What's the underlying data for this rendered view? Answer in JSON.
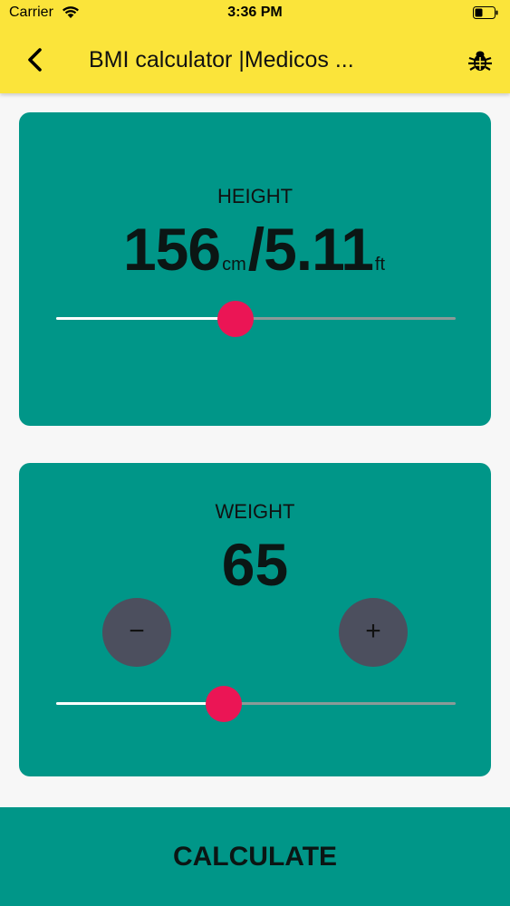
{
  "status_bar": {
    "carrier": "Carrier",
    "time": "3:36 PM"
  },
  "app_bar": {
    "title": "BMI calculator |Medicos ...",
    "background": "#fbe43a",
    "back_icon": "back-chevron-icon",
    "action_icon": "bug-icon"
  },
  "height_card": {
    "label": "HEIGHT",
    "value_cm": "156",
    "unit_cm": "cm",
    "separator": "/",
    "value_ft": "5.11",
    "unit_ft": "ft",
    "slider_fraction": 0.45
  },
  "weight_card": {
    "label": "WEIGHT",
    "value": "65",
    "minus_label": "−",
    "plus_label": "+",
    "slider_fraction": 0.42
  },
  "calculate_button": {
    "label": "CALCULATE"
  },
  "colors": {
    "card": "#009688",
    "thumb": "#eb1555",
    "round_button": "#4c4f5e",
    "page_bg": "#f7f7f7"
  }
}
